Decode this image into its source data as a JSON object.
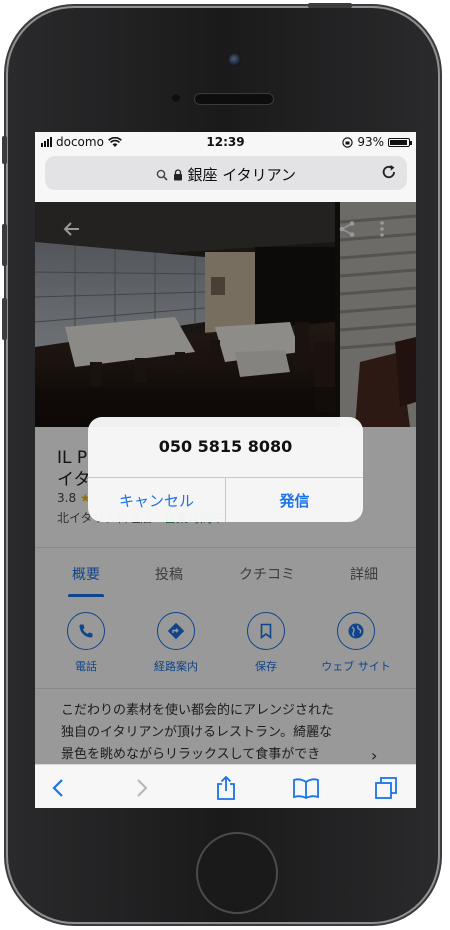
{
  "status_bar": {
    "carrier": "docomo",
    "time": "12:39",
    "battery": "93%",
    "battery_level": 0.93
  },
  "browser": {
    "url_text": "銀座 イタリアン"
  },
  "place": {
    "title_line1": "IL P",
    "title_line2": "イタ",
    "rating": "3.8",
    "category": "北イタリア料理店",
    "open_status": "営業時間中"
  },
  "tabs": [
    {
      "label": "概要",
      "active": true
    },
    {
      "label": "投稿",
      "active": false
    },
    {
      "label": "クチコミ",
      "active": false
    },
    {
      "label": "詳細",
      "active": false
    }
  ],
  "actions": [
    {
      "label": "電話",
      "icon": "phone-icon"
    },
    {
      "label": "経路案内",
      "icon": "directions-icon"
    },
    {
      "label": "保存",
      "icon": "bookmark-icon"
    },
    {
      "label": "ウェブ サイト",
      "icon": "globe-icon"
    }
  ],
  "description": {
    "line1": "こだわりの素材を使い都会的にアレンジされた",
    "line2": "独自のイタリアンが頂けるレストラン。綺麗な",
    "line3": "景色を眺めながらリラックスして食事ができ",
    "more": "›"
  },
  "alert": {
    "title": "050 5815 8080",
    "cancel": "キャンセル",
    "call": "発信"
  },
  "colors": {
    "accent": "#1a73e8",
    "open_green": "#1e8e3e"
  }
}
